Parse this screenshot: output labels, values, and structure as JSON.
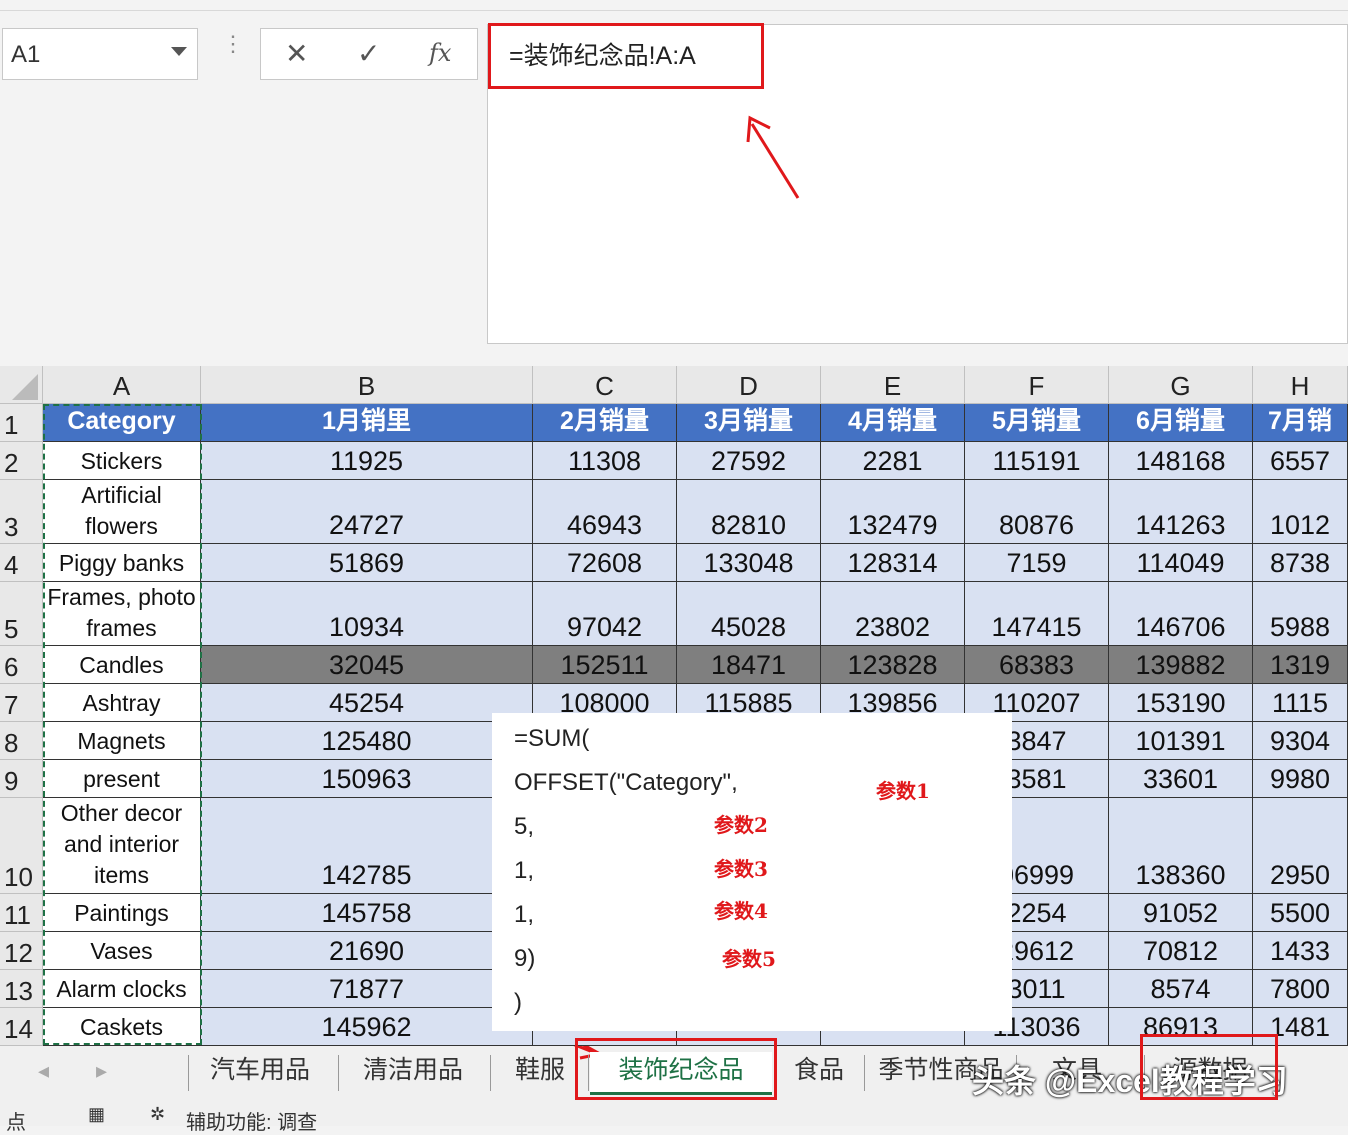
{
  "namebox": {
    "value": "A1"
  },
  "formula_bar": {
    "cancel_label": "✕",
    "enter_label": "✓",
    "fx_label": "fx",
    "formula": "=装饰纪念品!A:A"
  },
  "columns": [
    "A",
    "B",
    "C",
    "D",
    "E",
    "F",
    "G",
    "H"
  ],
  "header_row": [
    "Category",
    "1月销里",
    "2月销量",
    "3月销量",
    "4月销量",
    "5月销量",
    "6月销量",
    "7月销"
  ],
  "rows": [
    {
      "num": "2",
      "cells": [
        "Stickers",
        "11925",
        "11308",
        "27592",
        "2281",
        "115191",
        "148168",
        "6557"
      ]
    },
    {
      "num": "3",
      "cells": [
        "Artificial flowers",
        "24727",
        "46943",
        "82810",
        "132479",
        "80876",
        "141263",
        "1012"
      ]
    },
    {
      "num": "4",
      "cells": [
        "Piggy banks",
        "51869",
        "72608",
        "133048",
        "128314",
        "7159",
        "114049",
        "8738"
      ]
    },
    {
      "num": "5",
      "cells": [
        "Frames, photo frames",
        "10934",
        "97042",
        "45028",
        "23802",
        "147415",
        "146706",
        "5988"
      ]
    },
    {
      "num": "6",
      "cells": [
        "Candles",
        "32045",
        "152511",
        "18471",
        "123828",
        "68383",
        "139882",
        "1319"
      ]
    },
    {
      "num": "7",
      "cells": [
        "Ashtray",
        "45254",
        "108000",
        "115885",
        "139856",
        "110207",
        "153190",
        "1115"
      ]
    },
    {
      "num": "8",
      "cells": [
        "Magnets",
        "125480",
        "",
        "",
        "",
        "3847",
        "101391",
        "9304"
      ]
    },
    {
      "num": "9",
      "cells": [
        "present",
        "150963",
        "",
        "",
        "",
        "3581",
        "33601",
        "9980"
      ]
    },
    {
      "num": "10",
      "cells": [
        "Other decor and interior items",
        "142785",
        "",
        "",
        "",
        "06999",
        "138360",
        "2950"
      ]
    },
    {
      "num": "11",
      "cells": [
        "Paintings",
        "145758",
        "",
        "",
        "",
        "2254",
        "91052",
        "5500"
      ]
    },
    {
      "num": "12",
      "cells": [
        "Vases",
        "21690",
        "",
        "",
        "",
        "29612",
        "70812",
        "1433"
      ]
    },
    {
      "num": "13",
      "cells": [
        "Alarm clocks",
        "71877",
        "",
        "",
        "",
        "3011",
        "8574",
        "7800"
      ]
    },
    {
      "num": "14",
      "cells": [
        "Caskets",
        "145962",
        "",
        "",
        "",
        "113036",
        "86913",
        "1481"
      ]
    }
  ],
  "popup": {
    "lines": [
      "=SUM(",
      "OFFSET(\"Category\",",
      "5,",
      "1,",
      "1,",
      "9)",
      ")"
    ],
    "params": [
      "参数1",
      "参数2",
      "参数3",
      "参数4",
      "参数5"
    ]
  },
  "tabs": [
    "汽车用品",
    "清洁用品",
    "鞋服",
    "装饰纪念品",
    "食品",
    "季节性商品",
    "文具",
    "源数据"
  ],
  "active_tab": "装饰纪念品",
  "statusbar": {
    "left": "点",
    "accessibility": "辅助功能: 调查"
  },
  "watermark": "头条 @Excel教程学习",
  "colors": {
    "header_blue": "#4472c4",
    "data_fill": "#d9e1f2",
    "highlight_row": "#7f7f7f",
    "annotation_red": "#e0181b",
    "accent_green": "#1e7145"
  }
}
